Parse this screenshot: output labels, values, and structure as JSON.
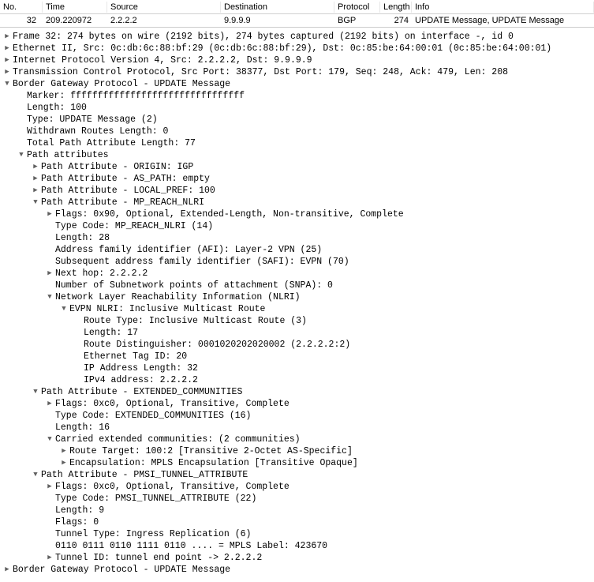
{
  "packet_list": {
    "headers": [
      "No.",
      "Time",
      "Source",
      "Destination",
      "Protocol",
      "Length",
      "Info"
    ],
    "row": {
      "no": "32",
      "time": "209.220972",
      "source": "2.2.2.2",
      "destination": "9.9.9.9",
      "protocol": "BGP",
      "length": "274",
      "info": "UPDATE Message, UPDATE Message"
    }
  },
  "details": [
    {
      "i": 0,
      "t": "closed",
      "text": "Frame 32: 274 bytes on wire (2192 bits), 274 bytes captured (2192 bits) on interface -, id 0"
    },
    {
      "i": 0,
      "t": "closed",
      "text": "Ethernet II, Src: 0c:db:6c:88:bf:29 (0c:db:6c:88:bf:29), Dst: 0c:85:be:64:00:01 (0c:85:be:64:00:01)"
    },
    {
      "i": 0,
      "t": "closed",
      "text": "Internet Protocol Version 4, Src: 2.2.2.2, Dst: 9.9.9.9"
    },
    {
      "i": 0,
      "t": "closed",
      "text": "Transmission Control Protocol, Src Port: 38377, Dst Port: 179, Seq: 248, Ack: 479, Len: 208"
    },
    {
      "i": 0,
      "t": "open",
      "text": "Border Gateway Protocol - UPDATE Message"
    },
    {
      "i": 1,
      "t": "none",
      "text": "Marker: ffffffffffffffffffffffffffffffff"
    },
    {
      "i": 1,
      "t": "none",
      "text": "Length: 100"
    },
    {
      "i": 1,
      "t": "none",
      "text": "Type: UPDATE Message (2)"
    },
    {
      "i": 1,
      "t": "none",
      "text": "Withdrawn Routes Length: 0"
    },
    {
      "i": 1,
      "t": "none",
      "text": "Total Path Attribute Length: 77"
    },
    {
      "i": 1,
      "t": "open",
      "text": "Path attributes"
    },
    {
      "i": 2,
      "t": "closed",
      "text": "Path Attribute - ORIGIN: IGP"
    },
    {
      "i": 2,
      "t": "closed",
      "text": "Path Attribute - AS_PATH: empty"
    },
    {
      "i": 2,
      "t": "closed",
      "text": "Path Attribute - LOCAL_PREF: 100"
    },
    {
      "i": 2,
      "t": "open",
      "text": "Path Attribute - MP_REACH_NLRI"
    },
    {
      "i": 3,
      "t": "closed",
      "text": "Flags: 0x90, Optional, Extended-Length, Non-transitive, Complete"
    },
    {
      "i": 3,
      "t": "none",
      "text": "Type Code: MP_REACH_NLRI (14)"
    },
    {
      "i": 3,
      "t": "none",
      "text": "Length: 28"
    },
    {
      "i": 3,
      "t": "none",
      "text": "Address family identifier (AFI): Layer-2 VPN (25)"
    },
    {
      "i": 3,
      "t": "none",
      "text": "Subsequent address family identifier (SAFI): EVPN (70)"
    },
    {
      "i": 3,
      "t": "closed",
      "text": "Next hop: 2.2.2.2"
    },
    {
      "i": 3,
      "t": "none",
      "text": "Number of Subnetwork points of attachment (SNPA): 0"
    },
    {
      "i": 3,
      "t": "open",
      "text": "Network Layer Reachability Information (NLRI)"
    },
    {
      "i": 4,
      "t": "open",
      "text": "EVPN NLRI: Inclusive Multicast Route"
    },
    {
      "i": 5,
      "t": "none",
      "text": "Route Type: Inclusive Multicast Route (3)"
    },
    {
      "i": 5,
      "t": "none",
      "text": "Length: 17"
    },
    {
      "i": 5,
      "t": "none",
      "text": "Route Distinguisher: 0001020202020002 (2.2.2.2:2)"
    },
    {
      "i": 5,
      "t": "none",
      "text": "Ethernet Tag ID: 20"
    },
    {
      "i": 5,
      "t": "none",
      "text": "IP Address Length: 32"
    },
    {
      "i": 5,
      "t": "none",
      "text": "IPv4 address: 2.2.2.2"
    },
    {
      "i": 2,
      "t": "open",
      "text": "Path Attribute - EXTENDED_COMMUNITIES"
    },
    {
      "i": 3,
      "t": "closed",
      "text": "Flags: 0xc0, Optional, Transitive, Complete"
    },
    {
      "i": 3,
      "t": "none",
      "text": "Type Code: EXTENDED_COMMUNITIES (16)"
    },
    {
      "i": 3,
      "t": "none",
      "text": "Length: 16"
    },
    {
      "i": 3,
      "t": "open",
      "text": "Carried extended communities: (2 communities)"
    },
    {
      "i": 4,
      "t": "closed",
      "text": "Route Target: 100:2 [Transitive 2-Octet AS-Specific]"
    },
    {
      "i": 4,
      "t": "closed",
      "text": "Encapsulation: MPLS Encapsulation [Transitive Opaque]"
    },
    {
      "i": 2,
      "t": "open",
      "text": "Path Attribute - PMSI_TUNNEL_ATTRIBUTE"
    },
    {
      "i": 3,
      "t": "closed",
      "text": "Flags: 0xc0, Optional, Transitive, Complete"
    },
    {
      "i": 3,
      "t": "none",
      "text": "Type Code: PMSI_TUNNEL_ATTRIBUTE (22)"
    },
    {
      "i": 3,
      "t": "none",
      "text": "Length: 9"
    },
    {
      "i": 3,
      "t": "none",
      "text": "Flags: 0"
    },
    {
      "i": 3,
      "t": "none",
      "text": "Tunnel Type: Ingress Replication (6)"
    },
    {
      "i": 3,
      "t": "none",
      "text": "0110 0111 0110 1111 0110 .... = MPLS Label: 423670"
    },
    {
      "i": 3,
      "t": "closed",
      "text": "Tunnel ID: tunnel end point -> 2.2.2.2"
    },
    {
      "i": 0,
      "t": "closed",
      "text": "Border Gateway Protocol - UPDATE Message"
    }
  ]
}
